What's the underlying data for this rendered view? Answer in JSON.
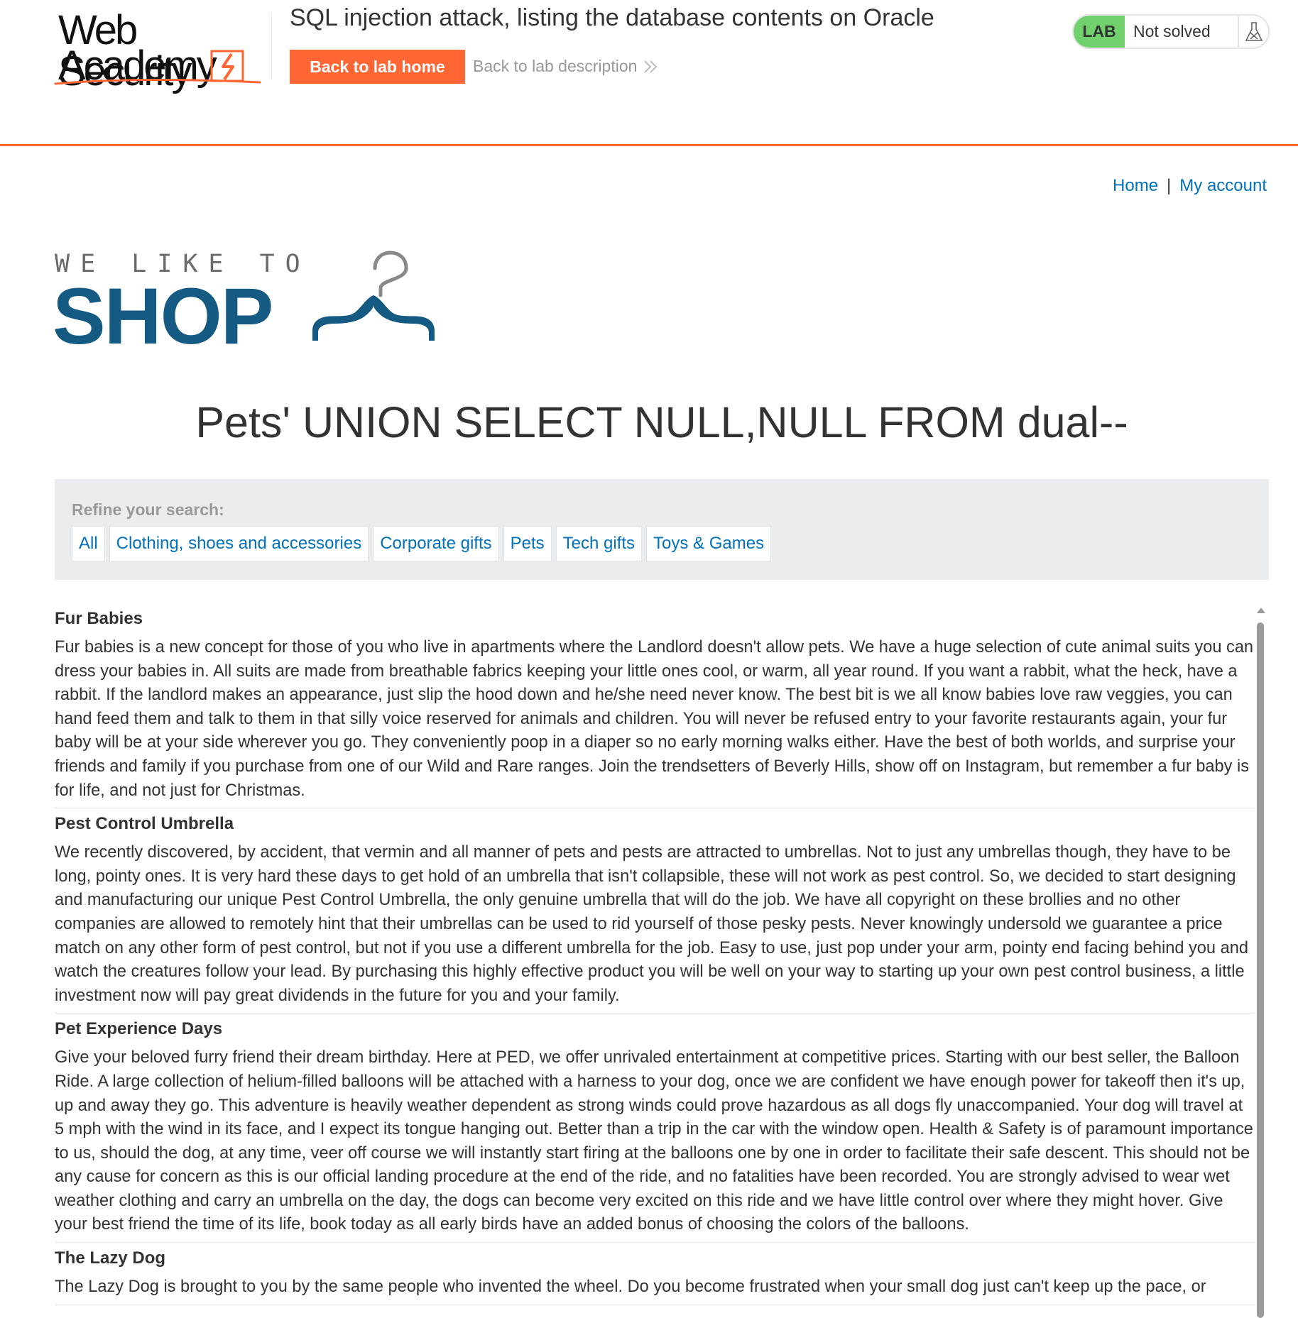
{
  "academy": {
    "logo_line1": "Web Security",
    "logo_line2": "Academy",
    "lab_title": "SQL injection attack, listing the database contents on Oracle",
    "back_home_label": "Back to lab home",
    "back_description_label": "Back to lab description",
    "lab_badge": "LAB",
    "lab_status": "Not solved"
  },
  "nav": {
    "home": "Home",
    "separator": "|",
    "my_account": "My account"
  },
  "shop_logo": {
    "line1": "WE LIKE TO",
    "line2": "SHOP"
  },
  "heading": "Pets' UNION SELECT NULL,NULL FROM dual--",
  "filters": {
    "label": "Refine your search:",
    "categories": [
      "All",
      "Clothing, shoes and accessories",
      "Corporate gifts",
      "Pets",
      "Tech gifts",
      "Toys & Games"
    ]
  },
  "products": [
    {
      "name": "Fur Babies",
      "description": "Fur babies is a new concept for those of you who live in apartments where the Landlord doesn't allow pets. We have a huge selection of cute animal suits you can dress your babies in. All suits are made from breathable fabrics keeping your little ones cool, or warm, all year round. If you want a rabbit, what the heck, have a rabbit. If the landlord makes an appearance, just slip the hood down and he/she need never know. The best bit is we all know babies love raw veggies, you can hand feed them and talk to them in that silly voice reserved for animals and children. You will never be refused entry to your favorite restaurants again, your fur baby will be at your side wherever you go. They conveniently poop in a diaper so no early morning walks either. Have the best of both worlds, and surprise your friends and family if you purchase from one of our Wild and Rare ranges. Join the trendsetters of Beverly Hills, show off on Instagram, but remember a fur baby is for life, and not just for Christmas."
    },
    {
      "name": "Pest Control Umbrella",
      "description": "We recently discovered, by accident, that vermin and all manner of pets and pests are attracted to umbrellas. Not to just any umbrellas though, they have to be long, pointy ones. It is very hard these days to get hold of an umbrella that isn't collapsible, these will not work as pest control. So, we decided to start designing and manufacturing our unique Pest Control Umbrella, the only genuine umbrella that will do the job. We have all copyright on these brollies and no other companies are allowed to remotely hint that their umbrellas can be used to rid yourself of those pesky pests. Never knowingly undersold we guarantee a price match on any other form of pest control, but not if you use a different umbrella for the job. Easy to use, just pop under your arm, pointy end facing behind you and watch the creatures follow your lead. By purchasing this highly effective product you will be well on your way to starting up your own pest control business, a little investment now will pay great dividends in the future for you and your family."
    },
    {
      "name": "Pet Experience Days",
      "description": "Give your beloved furry friend their dream birthday. Here at PED, we offer unrivaled entertainment at competitive prices. Starting with our best seller, the Balloon Ride. A large collection of helium-filled balloons will be attached with a harness to your dog, once we are confident we have enough power for takeoff then it's up, up and away they go. This adventure is heavily weather dependent as strong winds could prove hazardous as all dogs fly unaccompanied. Your dog will travel at 5 mph with the wind in its face, and I expect its tongue hanging out. Better than a trip in the car with the window open. Health & Safety is of paramount importance to us, should the dog, at any time, veer off course we will instantly start firing at the balloons one by one in order to facilitate their safe descent. This should not be any cause for concern as this is our official landing procedure at the end of the ride, and no fatalities have been recorded. You are strongly advised to wear wet weather clothing and carry an umbrella on the day, the dogs can become very excited on this ride and we have little control over where they might hover. Give your best friend the time of its life, book today as all early birds have an added bonus of choosing the colors of the balloons."
    },
    {
      "name": "The Lazy Dog",
      "description": "The Lazy Dog is brought to you by the same people who invented the wheel. Do you become frustrated when your small dog just can't keep up the pace, or"
    }
  ],
  "colors": {
    "accent": "#ff6633",
    "link": "#0071bc",
    "shop_blue": "#155a83",
    "lab_badge_green": "#70d16d",
    "filter_bg": "#e9edf0"
  },
  "icons": [
    "lightning-bolt-icon",
    "double-chevron-right-icon",
    "flask-icon",
    "hanger-icon",
    "scroll-up-arrow-icon"
  ]
}
